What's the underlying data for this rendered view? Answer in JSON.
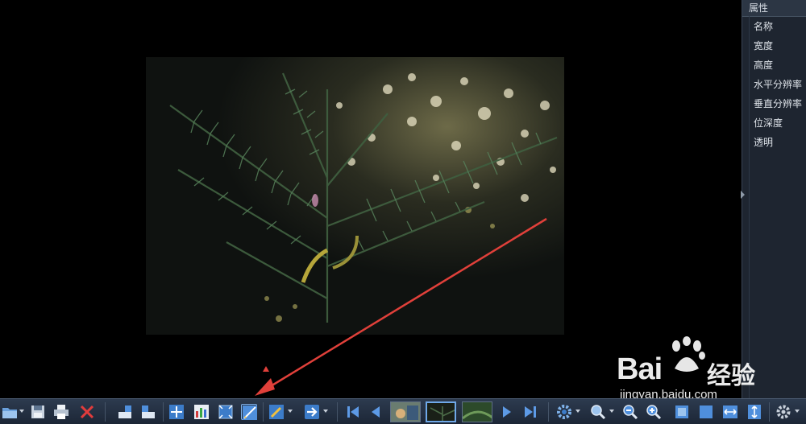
{
  "panel": {
    "title": "属性",
    "items": [
      "名称",
      "宽度",
      "高度",
      "水平分辨率",
      "垂直分辨率",
      "位深度",
      "透明"
    ]
  },
  "watermark": {
    "brand": "Bai",
    "brand_cn": "经验",
    "url": "jingyan.baidu.com"
  },
  "toolbar": {
    "icons": [
      "open-folder",
      "save",
      "print",
      "delete",
      "rotate-left",
      "rotate-right",
      "move",
      "levels",
      "fit-window",
      "edit-image",
      "annotate",
      "export",
      "first",
      "previous",
      "thumbnail",
      "thumbnail",
      "thumbnail",
      "next",
      "last",
      "settings",
      "zoom",
      "zoom-out",
      "zoom-in",
      "fit-page",
      "actual-size",
      "fit-width",
      "fit-height",
      "options"
    ]
  },
  "colors": {
    "accent": "#3d7fd0",
    "annotation_arrow": "#e0403a",
    "toolbar_bg": "#1c2636"
  }
}
